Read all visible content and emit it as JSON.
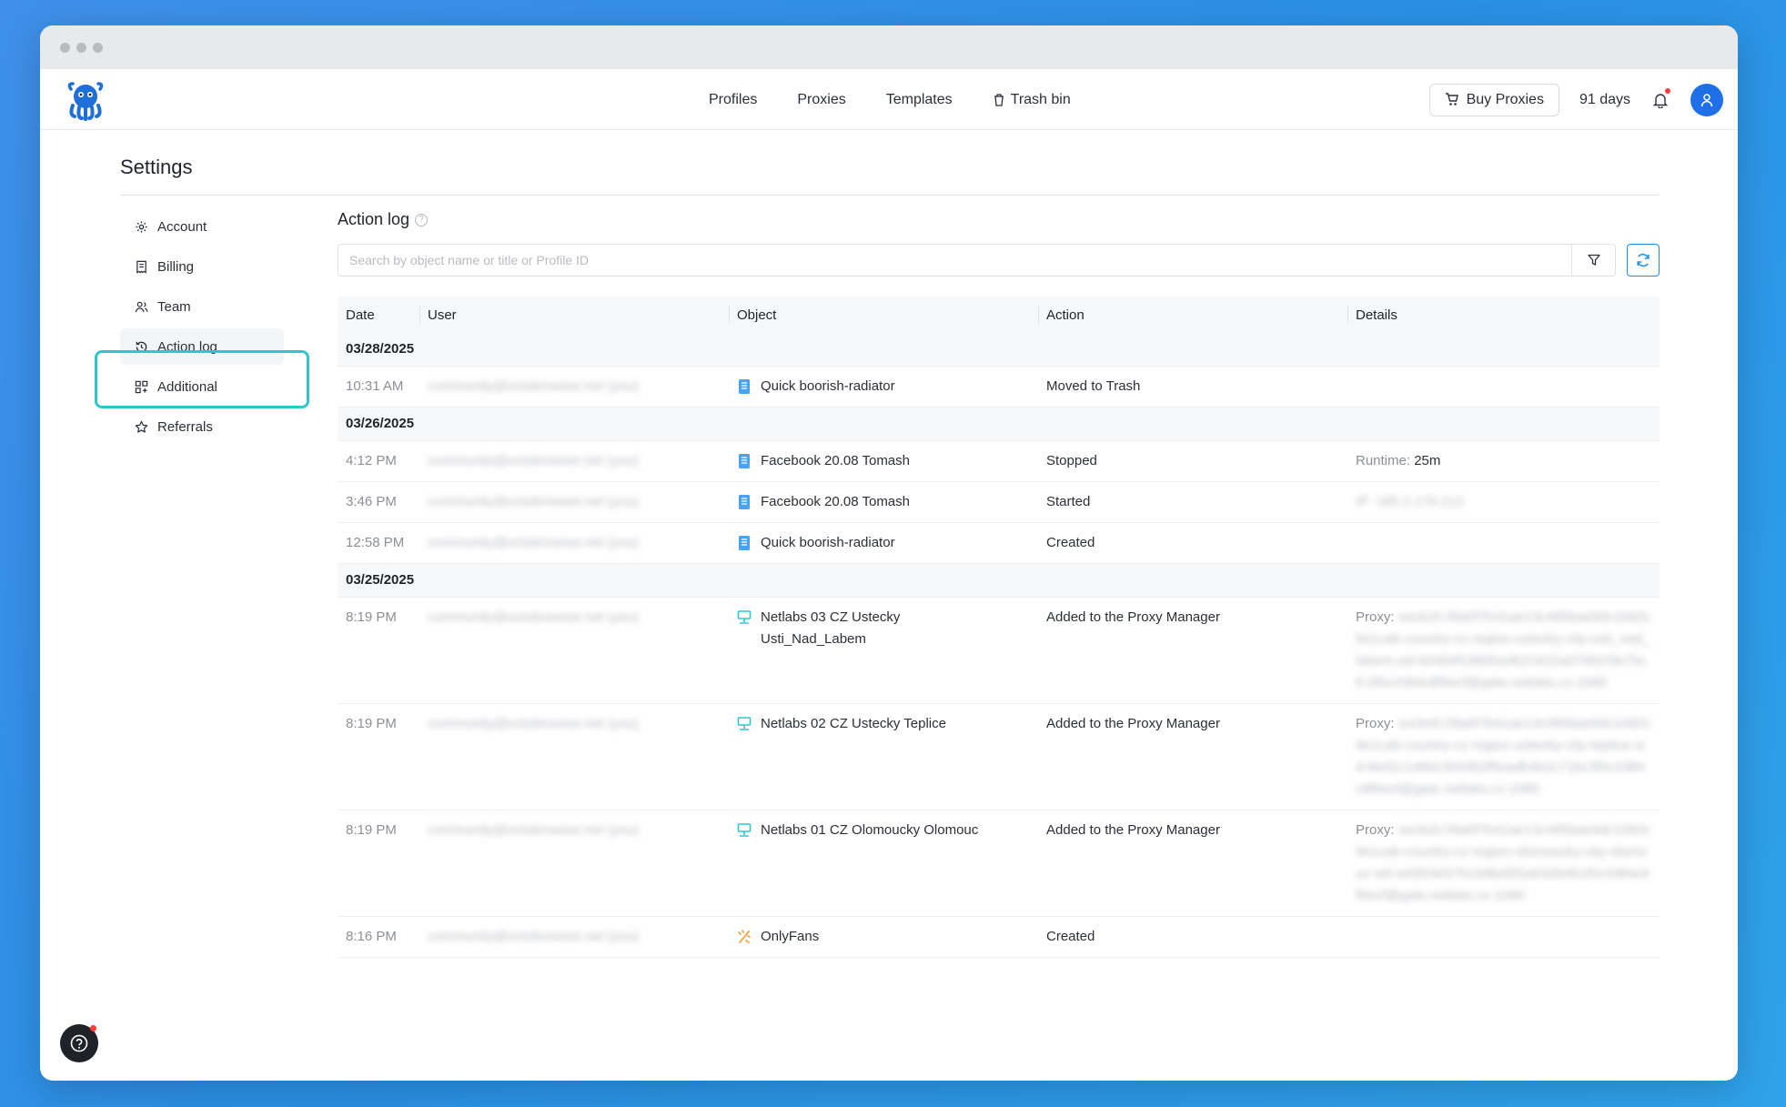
{
  "nav": {
    "links": [
      "Profiles",
      "Proxies",
      "Templates",
      "Trash bin"
    ],
    "buy_proxies": "Buy Proxies",
    "days": "91 days"
  },
  "settings": {
    "title": "Settings",
    "sidebar": [
      {
        "label": "Account",
        "icon": "gear-icon"
      },
      {
        "label": "Billing",
        "icon": "receipt-icon"
      },
      {
        "label": "Team",
        "icon": "team-icon"
      },
      {
        "label": "Action log",
        "icon": "history-icon"
      },
      {
        "label": "Additional",
        "icon": "grid-icon"
      },
      {
        "label": "Referrals",
        "icon": "star-icon"
      }
    ]
  },
  "action_log": {
    "title": "Action log",
    "search_placeholder": "Search by object name or title or Profile ID",
    "columns": [
      "Date",
      "User",
      "Object",
      "Action",
      "Details"
    ],
    "groups": [
      {
        "date": "03/28/2025",
        "rows": [
          {
            "time": "10:31 AM",
            "user": "community@octobrowser.net (you)",
            "object": "Quick boorish-radiator",
            "object_type": "profile",
            "action": "Moved to Trash",
            "details_label": "",
            "details": ""
          }
        ]
      },
      {
        "date": "03/26/2025",
        "rows": [
          {
            "time": "4:12 PM",
            "user": "community@octobrowser.net (you)",
            "object": "Facebook 20.08 Tomash",
            "object_type": "profile",
            "action": "Stopped",
            "details_label": "Runtime:",
            "details": "25m"
          },
          {
            "time": "3:46 PM",
            "user": "community@octobrowser.net (you)",
            "object": "Facebook 20.08 Tomash",
            "object_type": "profile",
            "action": "Started",
            "details_label": "",
            "details": "IP: 185.2.176.212"
          },
          {
            "time": "12:58 PM",
            "user": "community@octobrowser.net (you)",
            "object": "Quick boorish-radiator",
            "object_type": "profile",
            "action": "Created",
            "details_label": "",
            "details": ""
          }
        ]
      },
      {
        "date": "03/25/2025",
        "rows": [
          {
            "time": "8:19 PM",
            "user": "community@octobrowser.net (you)",
            "object": "Netlabs 03 CZ Ustecky Usti_Nad_Labem",
            "object_type": "proxy",
            "action": "Added to the Proxy Manager",
            "details_label": "Proxy:",
            "details": "socks5://8a0f7b41ae13c485bae9dc1082c9e1cab-country-cz-region-ustecky-city-usti_nad_labem-sid-b04b9f1882ba4b21622a07681f3e7bc6:2f0c4384c8f9ecf@gate.netlabs.cc:1080"
          },
          {
            "time": "8:19 PM",
            "user": "community@octobrowser.net (you)",
            "object": "Netlabs 02 CZ Ustecky Teplice",
            "object_type": "proxy",
            "action": "Added to the Proxy Manager",
            "details_label": "Proxy:",
            "details": "socks5://8a0f7b41ae13c485bae9dc1082c9e1cab-country-cz-region-ustecky-city-teplice-sid-8ed1c1480c3043b2f6eadb4b2c71bc3f0c4384c8f9ecf@gate.netlabs.cc:1080"
          },
          {
            "time": "8:19 PM",
            "user": "community@octobrowser.net (you)",
            "object": "Netlabs 01 CZ Olomoucky Olomouc",
            "object_type": "proxy",
            "action": "Added to the Proxy Manager",
            "details_label": "Proxy:",
            "details": "socks5://8a0f7b41ae13c485bae9dc1082c9e1cab-country-cz-region-olomoucky-city-olomouc-sid-ad3f24027b1b9bd2f2a932b4b1f0c4384c8f9ecf@gate.netlabs.cc:1080"
          },
          {
            "time": "8:16 PM",
            "user": "community@octobrowser.net (you)",
            "object": "OnlyFans",
            "object_type": "template",
            "action": "Created",
            "details_label": "",
            "details": ""
          }
        ]
      }
    ]
  },
  "colors": {
    "accent": "#1e8fe8",
    "highlight": "#2ec7cf",
    "proxy_icon": "#2ec7cf",
    "profile_icon": "#4aa3f0",
    "template_icon": "#f5a34a"
  }
}
